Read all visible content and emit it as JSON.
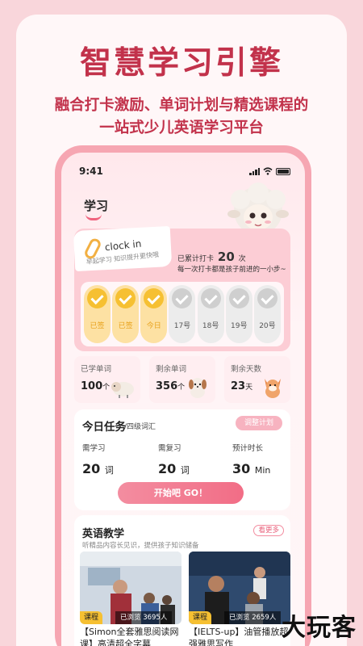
{
  "hero": {
    "title": "智慧学习引擎",
    "subtitle_line1": "融合打卡激励、单词计划与精选课程的",
    "subtitle_line2": "一站式少儿英语学习平台"
  },
  "status_bar": {
    "time": "9:41"
  },
  "page": {
    "title": "学习"
  },
  "checkin": {
    "label": "clock in",
    "sub": "早起学习 知识提升更快哦",
    "total_prefix": "已累计打卡",
    "total_count": "20",
    "total_suffix": "次",
    "motto": "每一次打卡都是孩子前进的一小步~",
    "days": [
      {
        "label": "已签",
        "done": true
      },
      {
        "label": "已签",
        "done": true
      },
      {
        "label": "今日",
        "done": true
      },
      {
        "label": "17号",
        "done": false
      },
      {
        "label": "18号",
        "done": false
      },
      {
        "label": "19号",
        "done": false
      },
      {
        "label": "20号",
        "done": false
      }
    ]
  },
  "stats": [
    {
      "label": "已学单词",
      "value": "100",
      "unit": "个",
      "icon": "sheep-icon"
    },
    {
      "label": "剩余单词",
      "value": "356",
      "unit": "个",
      "icon": "puppy-icon"
    },
    {
      "label": "剩余天数",
      "value": "23",
      "unit": "天",
      "icon": "fox-icon"
    }
  ],
  "task": {
    "title": "今日任务",
    "level": "/四级词汇",
    "adjust_label": "调整计划",
    "metrics": [
      {
        "label": "需学习",
        "value": "20",
        "unit": "词"
      },
      {
        "label": "需复习",
        "value": "20",
        "unit": "词"
      },
      {
        "label": "预计时长",
        "value": "30",
        "unit": "Min"
      }
    ],
    "start_label": "开始吧 GO！"
  },
  "courses_section": {
    "title": "英语教学",
    "subtitle": "听精品内容长见识，提供孩子知识储备",
    "more_label": "看更多",
    "items": [
      {
        "badge": "课程",
        "views": "已浏览 3695人",
        "name": "【Simon全套雅思阅读网课】高清超全字幕"
      },
      {
        "badge": "课程",
        "views": "已浏览 2659人",
        "name": "【IELTS-up】油管播放超强雅思写作"
      }
    ]
  },
  "watermark": "大玩客",
  "colors": {
    "brand": "#c2324b",
    "accent": "#f26d86",
    "gold": "#f6c032"
  }
}
